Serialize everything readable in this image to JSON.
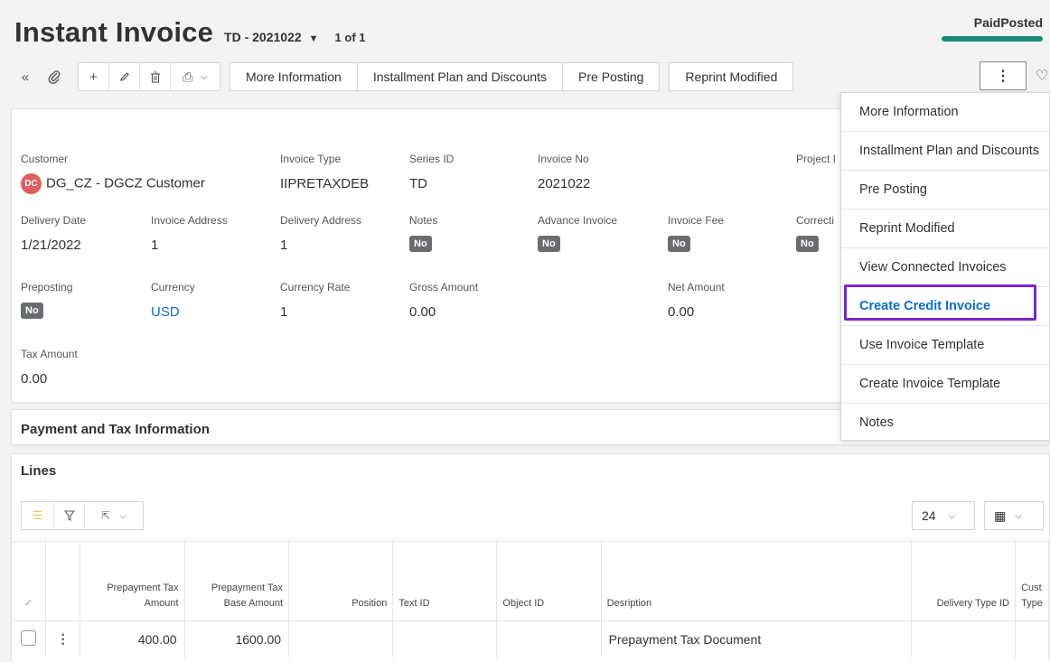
{
  "header": {
    "title": "Instant Invoice",
    "doc_id": "TD - 2021022",
    "count": "1 of 1",
    "status_label": "PaidPosted"
  },
  "toolbar": {
    "buttons": [
      "More Information",
      "Installment Plan and Discounts",
      "Pre Posting",
      "Reprint Modified"
    ],
    "more_label": "⋮"
  },
  "fields": {
    "customer": {
      "label": "Customer",
      "value": "DG_CZ - DGCZ Customer",
      "avatar": "DC"
    },
    "invoice_type": {
      "label": "Invoice Type",
      "value": "IIPRETAXDEB"
    },
    "series_id": {
      "label": "Series ID",
      "value": "TD"
    },
    "invoice_no": {
      "label": "Invoice No",
      "value": "2021022"
    },
    "project": {
      "label": "Project I"
    },
    "delivery_date": {
      "label": "Delivery Date",
      "value": "1/21/2022"
    },
    "invoice_address": {
      "label": "Invoice Address",
      "value": "1"
    },
    "delivery_address": {
      "label": "Delivery Address",
      "value": "1"
    },
    "notes": {
      "label": "Notes",
      "value": "No"
    },
    "advance_invoice": {
      "label": "Advance Invoice",
      "value": "No"
    },
    "invoice_fee": {
      "label": "Invoice Fee",
      "value": "No"
    },
    "correction": {
      "label": "Correcti",
      "value": "No"
    },
    "preposting": {
      "label": "Preposting",
      "value": "No"
    },
    "currency": {
      "label": "Currency",
      "value": "USD"
    },
    "currency_rate": {
      "label": "Currency Rate",
      "value": "1"
    },
    "gross_amount": {
      "label": "Gross Amount",
      "value": "0.00"
    },
    "net_amount": {
      "label": "Net Amount",
      "value": "0.00"
    },
    "tax_amount": {
      "label": "Tax Amount",
      "value": "0.00"
    }
  },
  "sections": {
    "payment_tax": "Payment and Tax Information",
    "lines": "Lines"
  },
  "lines": {
    "page_size": "24",
    "columns": [
      "Prepayment Tax Amount",
      "Prepayment Tax Base Amount",
      "Position",
      "Text ID",
      "Object ID",
      "Desription",
      "Delivery Type ID",
      "Cust Type"
    ],
    "rows": [
      {
        "prepay_tax_amount": "400.00",
        "prepay_tax_base_amount": "1600.00",
        "position": "",
        "text_id": "",
        "object_id": "",
        "description": "Prepayment Tax Document",
        "delivery_type_id": ""
      }
    ]
  },
  "menu": {
    "items": [
      "More Information",
      "Installment Plan and Discounts",
      "Pre Posting",
      "Reprint Modified",
      "View Connected Invoices",
      "Create Credit Invoice",
      "Use Invoice Template",
      "Create Invoice Template",
      "Notes"
    ]
  },
  "colors": {
    "status_bar": "#1a8a78",
    "highlight_border": "#7e22ce",
    "link": "#0a6ed1"
  }
}
